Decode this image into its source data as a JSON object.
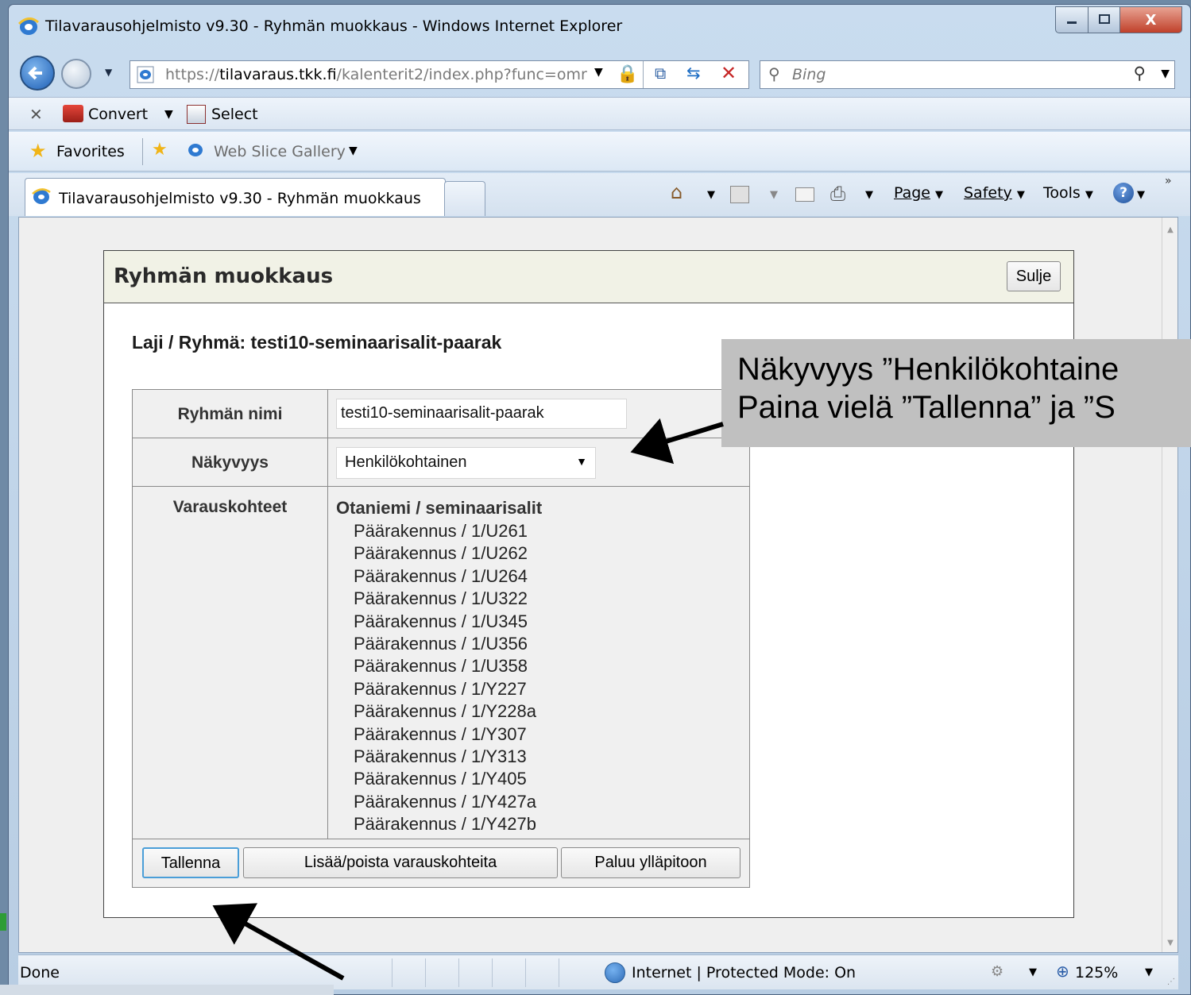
{
  "window": {
    "title": "Tilavarausohjelmisto v9.30 - Ryhmän muokkaus - Windows Internet Explorer",
    "minimize_icon": "minimize-icon",
    "maximize_icon": "maximize-icon",
    "close_label": "X"
  },
  "nav": {
    "back_icon": "back-arrow-icon",
    "forward_icon": "forward-arrow-icon",
    "address_scheme": "https://",
    "address_host": "tilavaraus.tkk.fi",
    "address_path": "/kalenterit2/index.php?func=omr",
    "search_placeholder": "Bing"
  },
  "commandbar": {
    "convert_label": "Convert",
    "select_label": "Select"
  },
  "favorites": {
    "favorites_label": "Favorites",
    "web_slice_label": "Web Slice Gallery"
  },
  "tabs": {
    "active_label": "Tilavarausohjelmisto v9.30 - Ryhmän muokkaus",
    "page_label": "Page",
    "safety_label": "Safety",
    "tools_label": "Tools",
    "help_label": "?"
  },
  "dialog": {
    "title": "Ryhmän muokkaus",
    "close_button": "Sulje",
    "group_heading": "Laji / Ryhmä: testi10-seminaarisalit-paarak",
    "fields": {
      "name_label": "Ryhmän nimi",
      "name_value": "testi10-seminaarisalit-paarak",
      "visibility_label": "Näkyvyys",
      "visibility_value": "Henkilökohtainen",
      "locations_label": "Varauskohteet"
    },
    "location_group": "Otaniemi / seminaarisalit",
    "locations": [
      "Päärakennus / 1/U261",
      "Päärakennus / 1/U262",
      "Päärakennus / 1/U264",
      "Päärakennus / 1/U322",
      "Päärakennus / 1/U345",
      "Päärakennus / 1/U356",
      "Päärakennus / 1/U358",
      "Päärakennus / 1/Y227",
      "Päärakennus / 1/Y228a",
      "Päärakennus / 1/Y307",
      "Päärakennus / 1/Y313",
      "Päärakennus / 1/Y405",
      "Päärakennus / 1/Y427a",
      "Päärakennus / 1/Y427b"
    ],
    "buttons": {
      "save": "Tallenna",
      "add_remove": "Lisää/poista varauskohteita",
      "back": "Paluu ylläpitoon"
    }
  },
  "statusbar": {
    "status": "Done",
    "zone": "Internet | Protected Mode: On",
    "zoom": "125%"
  },
  "annotation": {
    "line1": "Näkyvyys ”Henkilökohtaine",
    "line2": "Paina vielä ”Tallenna” ja ”S"
  }
}
